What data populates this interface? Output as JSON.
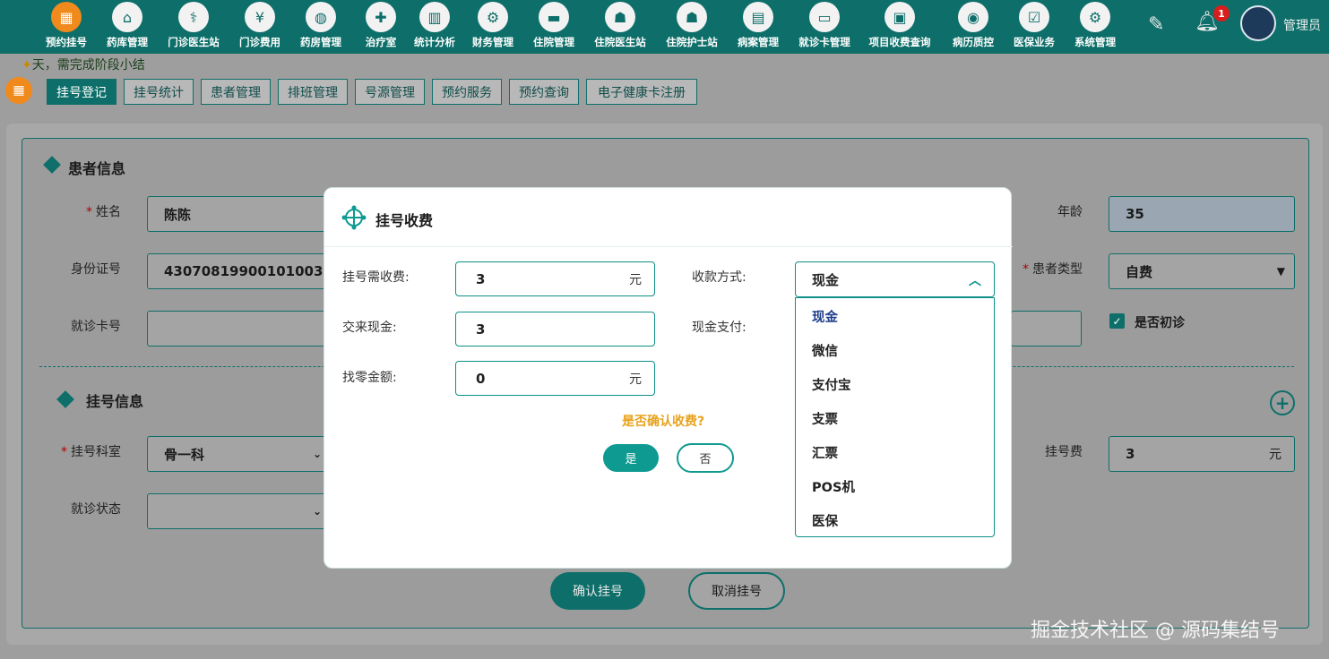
{
  "nav": {
    "items": [
      {
        "label": "预约挂号",
        "icon": "calendar-icon",
        "active": true
      },
      {
        "label": "药库管理",
        "icon": "pharmacy-icon"
      },
      {
        "label": "门诊医生站",
        "icon": "doctor-icon"
      },
      {
        "label": "门诊费用",
        "icon": "yen-icon"
      },
      {
        "label": "药房管理",
        "icon": "pill-icon"
      },
      {
        "label": "治疗室",
        "icon": "treatment-icon"
      },
      {
        "label": "统计分析",
        "icon": "chart-icon"
      },
      {
        "label": "财务管理",
        "icon": "gear-icon"
      },
      {
        "label": "住院管理",
        "icon": "bed-icon"
      },
      {
        "label": "住院医生站",
        "icon": "doctor-card-icon"
      },
      {
        "label": "住院护士站",
        "icon": "nurse-icon"
      },
      {
        "label": "病案管理",
        "icon": "file-icon"
      },
      {
        "label": "就诊卡管理",
        "icon": "card-icon"
      },
      {
        "label": "项目收费查询",
        "icon": "search-doc-icon"
      },
      {
        "label": "病历质控",
        "icon": "record-icon"
      },
      {
        "label": "医保业务",
        "icon": "insurance-icon"
      },
      {
        "label": "系统管理",
        "icon": "settings-icon"
      }
    ],
    "badge_count": "1",
    "user": "管理员"
  },
  "notice": "天，需完成阶段小结",
  "tabs": [
    "挂号登记",
    "挂号统计",
    "患者管理",
    "排班管理",
    "号源管理",
    "预约服务",
    "预约查询",
    "电子健康卡注册"
  ],
  "patient": {
    "section_title": "患者信息",
    "name_label": "姓名",
    "name": "陈陈",
    "id_label": "身份证号",
    "id_number": "43070819900101003",
    "card_label": "就诊卡号",
    "age_label": "年龄",
    "age": "35",
    "type_label": "患者类型",
    "type": "自费",
    "first_visit": "是否初诊"
  },
  "registration": {
    "section_title": "挂号信息",
    "dept_label": "挂号科室",
    "dept": "骨一科",
    "status_label": "就诊状态",
    "fee_label": "挂号费",
    "fee": "3",
    "unit": "元",
    "confirm": "确认挂号",
    "cancel": "取消挂号"
  },
  "modal": {
    "title": "挂号收费",
    "fee_label": "挂号需收费:",
    "fee": "3",
    "unit": "元",
    "paid_label": "交来现金:",
    "paid": "3",
    "change_label": "找零金额:",
    "change": "0",
    "method_label": "收款方式:",
    "cash_pay_label": "现金支付:",
    "method": "现金",
    "options": [
      "现金",
      "微信",
      "支付宝",
      "支票",
      "汇票",
      "POS机",
      "医保"
    ],
    "ask": "是否确认收费?",
    "yes": "是",
    "no": "否"
  },
  "watermark": "掘金技术社区 @ 源码集结号",
  "colors": {
    "primary": "#0e6f6a",
    "accent": "#f08a1c",
    "ask": "#e8a21c"
  }
}
